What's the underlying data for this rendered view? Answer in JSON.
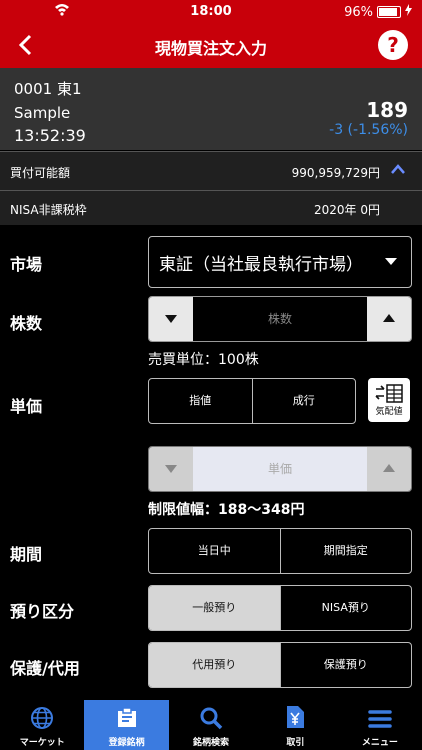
{
  "status": {
    "time": "18:00",
    "battery": "96%"
  },
  "header": {
    "title": "現物買注文入力",
    "help": "?"
  },
  "stock": {
    "code": "0001 東1",
    "name": "Sample",
    "time": "13:52:39",
    "price": "189",
    "change": "-3 (-1.56%)"
  },
  "info": {
    "buying_power_label": "買付可能額",
    "buying_power_value": "990,959,729円",
    "nisa_label": "NISA非課税枠",
    "nisa_value": "2020年 0円"
  },
  "form": {
    "market_label": "市場",
    "market_value": "東証（当社最良執行市場）",
    "shares_label": "株数",
    "shares_placeholder": "株数",
    "trade_unit": "売買単位：100株",
    "price_label": "単価",
    "price_types": [
      "指値",
      "成行"
    ],
    "quote_board": "気配値",
    "price_placeholder": "単価",
    "price_limit": "制限値幅：188〜348円",
    "period_label": "期間",
    "period_options": [
      "当日中",
      "期間指定"
    ],
    "custody_label": "預り区分",
    "custody_options": [
      "一般預り",
      "NISA預り"
    ],
    "protect_label": "保護/代用",
    "protect_options": [
      "代用預り",
      "保護預り"
    ]
  },
  "tabs": [
    {
      "label": "マーケット",
      "icon": "globe-icon"
    },
    {
      "label": "登録銘柄",
      "icon": "clipboard-icon"
    },
    {
      "label": "銘柄検索",
      "icon": "search-icon"
    },
    {
      "label": "取引",
      "icon": "yen-document-icon"
    },
    {
      "label": "メニュー",
      "icon": "menu-icon"
    }
  ],
  "colors": {
    "brand_red": "#c8000a",
    "accent_blue": "#3b7be0",
    "change_blue": "#3d8ee8"
  }
}
